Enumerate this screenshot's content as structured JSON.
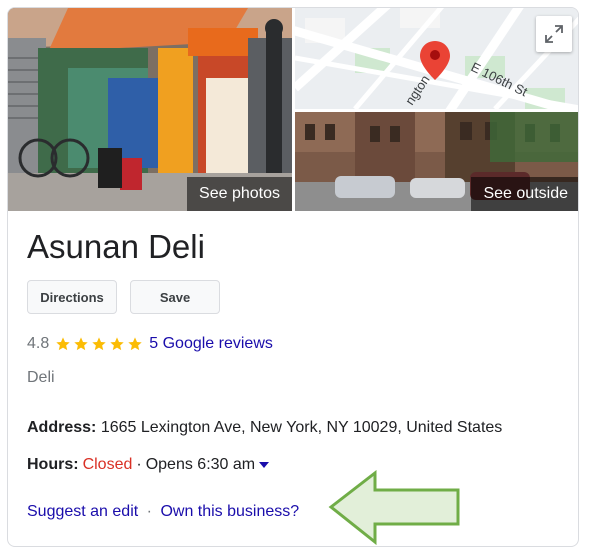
{
  "photos": {
    "see_photos_label": "See photos",
    "see_outside_label": "See outside",
    "map": {
      "street_label": "E 106th St",
      "avenue_label": "ngton A"
    }
  },
  "business": {
    "name": "Asunan Deli",
    "actions": {
      "directions_label": "Directions",
      "save_label": "Save"
    },
    "rating": {
      "value": "4.8",
      "stars": 5,
      "reviews_label": "5 Google reviews"
    },
    "category": "Deli",
    "address": {
      "key": "Address:",
      "value": "1665 Lexington Ave, New York, NY 10029, United States"
    },
    "hours": {
      "key": "Hours:",
      "status": "Closed",
      "separator": "·",
      "next": "Opens 6:30 am"
    },
    "links": {
      "suggest_edit": "Suggest an edit",
      "separator": "·",
      "own_business": "Own this business?"
    }
  },
  "colors": {
    "link": "#1a0dab",
    "closed": "#d93025",
    "star": "#fbbc04",
    "arrow_fill": "#e2efd9",
    "arrow_stroke": "#70ad47",
    "map_pin": "#ea4335"
  }
}
